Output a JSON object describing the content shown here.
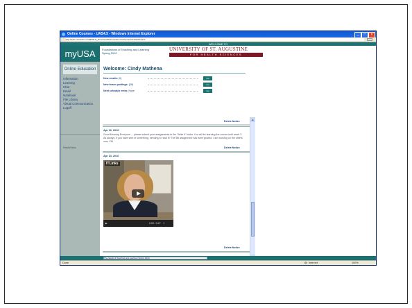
{
  "window": {
    "title": "Online Courses - UAS4.5 - Windows Internet Explorer",
    "url": "http://learn.usaonline.us/EDUE-H_0Courses/Fld/courshes.cfm?courseId=1&stdArea=1",
    "controls": {
      "minimize": "_",
      "maximize": "□",
      "close": "x"
    }
  },
  "site": {
    "strip_text": "WELCOME TO",
    "logo": "myUSA",
    "course_title": "Foundations of Teaching and Learning",
    "course_term": "Spring 2010",
    "university": "UNIVERSITY OF ST. AUGUSTINE",
    "university_sub": "FOR HEALTH SCIENCES"
  },
  "sidebar": {
    "heading": "Online Education",
    "items": [
      "Information",
      "Learning",
      "Chat",
      "Email",
      "Notebook",
      "File Library",
      "Virtual Communication",
      "Logoff"
    ],
    "help_text": "Helpful links"
  },
  "main": {
    "welcome": "Welcome: Cindy Mathena",
    "stats": [
      {
        "label": "New emails:",
        "value": "(0)",
        "button": "Go"
      },
      {
        "label": "New forum postings:",
        "value": "(26)",
        "button": "Go"
      },
      {
        "label": "Next schedule entry:",
        "value": "None",
        "button": "Go"
      }
    ]
  },
  "feed": {
    "delete_label": "Delete Notice",
    "posts": [
      {
        "date": "Apr 16, 2010",
        "body": "Good Morning Everyone ... please submit your assignments to the 'Write It' folder. You will be learning the course until week 3. As always, if you have sent in something, needing to read it? The Bb assignment has been graded. I am working on the others now. CM"
      },
      {
        "date": "Apr 13, 2010",
        "body": ""
      }
    ],
    "video": {
      "badge": "ITLinks",
      "time": "0:00 / 0:47"
    }
  },
  "bottom": {
    "selector": "The Ideals of Teaching and Learning Spring 2010"
  },
  "statusbar": {
    "left": "Done",
    "zone": "Internet",
    "zoom": "100%"
  },
  "colors": {
    "teal": "#1b7272",
    "uni_red": "#7a1a24",
    "title_blue": "#0a5bd8"
  }
}
